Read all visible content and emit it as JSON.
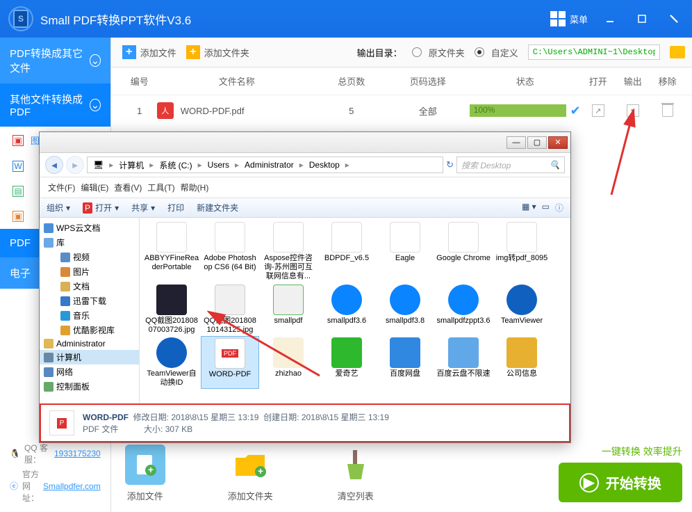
{
  "app": {
    "title": "Small  PDF转换PPT软件V3.6",
    "menu": "菜单"
  },
  "sidebar": {
    "group1_title": "PDF转换成其它文件",
    "group2_title": "其他文件转换成PDF",
    "items": [
      {
        "label": "图片转PDF",
        "icon_color": "#e03030"
      },
      {
        "label": "",
        "icon_color": "#2a7fd4"
      },
      {
        "label": "",
        "icon_color": "#3cb371"
      },
      {
        "label": "",
        "icon_color": "#e08030"
      }
    ],
    "group3_title": "PDF",
    "group4_title": "电子",
    "qq_label": "QQ 客服：",
    "qq": "1933175230",
    "site_label": "官方网址：",
    "site": "Smallpdfer.com"
  },
  "toolbar": {
    "add_file": "添加文件",
    "add_folder": "添加文件夹",
    "output_label": "输出目录：",
    "radio_original": "原文件夹",
    "radio_custom": "自定义",
    "path": "C:\\Users\\ADMINI~1\\Desktop"
  },
  "table": {
    "headers": {
      "num": "编号",
      "name": "文件名称",
      "pages": "总页数",
      "range": "页码选择",
      "status": "状态",
      "open": "打开",
      "out": "输出",
      "del": "移除"
    },
    "rows": [
      {
        "num": "1",
        "name": "WORD-PDF.pdf",
        "pages": "5",
        "range": "全部",
        "status": "100%"
      }
    ]
  },
  "bottom": {
    "add_file": "添加文件",
    "add_folder": "添加文件夹",
    "clear": "清空列表",
    "tagline": "一键转换  效率提升",
    "start": "开始转换"
  },
  "dialog": {
    "breadcrumb": [
      "计算机",
      "系统 (C:)",
      "Users",
      "Administrator",
      "Desktop"
    ],
    "search_placeholder": "搜索 Desktop",
    "menu": [
      "文件(F)",
      "编辑(E)",
      "查看(V)",
      "工具(T)",
      "帮助(H)"
    ],
    "tb": {
      "organize": "组织",
      "open": "打开",
      "share": "共享",
      "print": "打印",
      "new_folder": "新建文件夹"
    },
    "tree": [
      {
        "label": "WPS云文档",
        "icon": "#4a90d9",
        "cls": "root"
      },
      {
        "label": "库",
        "icon": "#6aa8e8",
        "cls": "root"
      },
      {
        "label": "视频",
        "icon": "#5a8cc8",
        "cls": "indent2"
      },
      {
        "label": "图片",
        "icon": "#d88838",
        "cls": "indent2"
      },
      {
        "label": "文档",
        "icon": "#d8b058",
        "cls": "indent2"
      },
      {
        "label": "迅雷下载",
        "icon": "#3878c8",
        "cls": "indent2"
      },
      {
        "label": "音乐",
        "icon": "#2898d8",
        "cls": "indent2"
      },
      {
        "label": "优酷影视库",
        "icon": "#e0a030",
        "cls": "indent2"
      },
      {
        "label": "Administrator",
        "icon": "#e0b858",
        "cls": "root"
      },
      {
        "label": "计算机",
        "icon": "#6888a8",
        "cls": "root",
        "selected": true
      },
      {
        "label": "网络",
        "icon": "#5888c0",
        "cls": "root"
      },
      {
        "label": "控制面板",
        "icon": "#68a868",
        "cls": "root"
      }
    ],
    "files_row1": [
      {
        "name": "ABBYYFineReaderPortable",
        "color": "#fff",
        "border": "#ddd"
      },
      {
        "name": "Adobe Photoshop CS6 (64 Bit)",
        "color": "#fff",
        "border": "#ddd"
      },
      {
        "name": "Aspose控件咨询-苏州图可互联网信息有...",
        "color": "#fff",
        "border": "#ddd"
      },
      {
        "name": "BDPDF_v6.5",
        "color": "#fff",
        "border": "#ddd"
      },
      {
        "name": "Eagle",
        "color": "#fff",
        "border": "#ddd"
      },
      {
        "name": "Google Chrome",
        "color": "#fff",
        "border": "#ddd"
      },
      {
        "name": "img转pdf_8095",
        "color": "#fff",
        "border": "#ddd"
      }
    ],
    "files_row2": [
      {
        "name": "QQ截图20180807003726.jpg",
        "color": "#202030"
      },
      {
        "name": "QQ截图20180810143125.jpg",
        "color": "#f0f0f0",
        "border": "#ccc"
      },
      {
        "name": "smallpdf",
        "color": "#f0f0f0",
        "border": "#5cb85c"
      },
      {
        "name": "smallpdf3.6",
        "color": "#0b84ff",
        "round": true
      },
      {
        "name": "smallpdf3.8",
        "color": "#0b84ff",
        "round": true
      },
      {
        "name": "smallpdfzppt3.6",
        "color": "#0b84ff",
        "round": true
      },
      {
        "name": "TeamViewer",
        "color": "#1060c0",
        "round": true
      }
    ],
    "files_row3": [
      {
        "name": "TeamViewer自动换ID",
        "color": "#1060c0",
        "round": true
      },
      {
        "name": "WORD-PDF",
        "color": "#fff",
        "border": "#ccc",
        "selected": true,
        "pdf": true
      },
      {
        "name": "zhizhao",
        "color": "#f8f0d8"
      },
      {
        "name": "爱奇艺",
        "color": "#2eb82e"
      },
      {
        "name": "百度网盘",
        "color": "#3088e0"
      },
      {
        "name": "百度云盘不限速",
        "color": "#60a8e8"
      },
      {
        "name": "公司信息",
        "color": "#e8b030"
      }
    ],
    "details": {
      "name": "WORD-PDF",
      "type": "PDF 文件",
      "mod_label": "修改日期:",
      "mod": "2018\\8\\15 星期三 13:19",
      "create_label": "创建日期:",
      "create": "2018\\8\\15 星期三 13:19",
      "size_label": "大小:",
      "size": "307 KB"
    }
  }
}
